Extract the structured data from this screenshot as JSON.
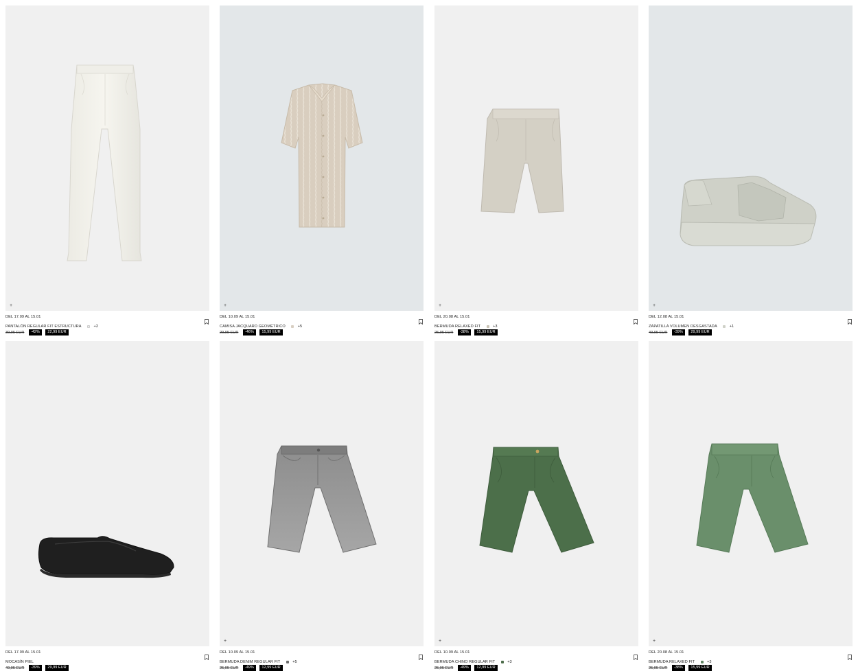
{
  "products": [
    {
      "date": "DEL 17.09 AL 15.01",
      "name": "PANTALÓN REGULAR FIT ESTRUCTURA",
      "swatch_color": "#ececec",
      "more_colors": "+2",
      "old_price": "39,95 EUR",
      "discount": "-42%",
      "new_price": "22,99 EUR",
      "bg": "#f0f0f0"
    },
    {
      "date": "DEL 10.09 AL 15.01",
      "name": "CAMISA JACQUARD GEOMÉTRICO",
      "swatch_color": "#d8cfc2",
      "more_colors": "+5",
      "old_price": "29,95 EUR",
      "discount": "-46%",
      "new_price": "15,99 EUR",
      "bg": "#e3e7e9"
    },
    {
      "date": "DEL 20.08 AL 15.01",
      "name": "BERMUDA RELAXED FIT",
      "swatch_color": "#c9c3b6",
      "more_colors": "+3",
      "old_price": "25,95 EUR",
      "discount": "-38%",
      "new_price": "15,99 EUR",
      "bg": "#f0f0f0"
    },
    {
      "date": "DEL 12.08 AL 15.01",
      "name": "ZAPATILLA VOLUMEN DESGASTADA",
      "swatch_color": "#cfd1c8",
      "more_colors": "+1",
      "old_price": "49,95 EUR",
      "discount": "-39%",
      "new_price": "29,99 EUR",
      "bg": "#e3e7e9"
    },
    {
      "date": "DEL 17.09 AL 15.01",
      "name": "MOCASÍN PIEL",
      "swatch_color": "",
      "more_colors": "",
      "old_price": "49,95 EUR",
      "discount": "-39%",
      "new_price": "29,99 EUR",
      "bg": "#f0f0f0"
    },
    {
      "date": "DEL 10.09 AL 15.01",
      "name": "BERMUDA DENIM REGULAR FIT",
      "swatch_color": "#6b6b6b",
      "more_colors": "+5",
      "old_price": "25,95 EUR",
      "discount": "-49%",
      "new_price": "12,99 EUR",
      "bg": "#f0f0f0"
    },
    {
      "date": "DEL 10.09 AL 15.01",
      "name": "BERMUDA CHINO REGULAR FIT",
      "swatch_color": "#4b6b49",
      "more_colors": "+3",
      "old_price": "25,95 EUR",
      "discount": "-49%",
      "new_price": "12,99 EUR",
      "bg": "#f0f0f0"
    },
    {
      "date": "DEL 20.08 AL 15.01",
      "name": "BERMUDA RELAXED FIT",
      "swatch_color": "#5f8462",
      "more_colors": "+3",
      "old_price": "25,95 EUR",
      "discount": "-38%",
      "new_price": "15,99 EUR",
      "bg": "#f0f0f0"
    }
  ],
  "icons": {
    "add": "plus-icon",
    "save": "bookmark-icon"
  },
  "add_symbol": "+"
}
